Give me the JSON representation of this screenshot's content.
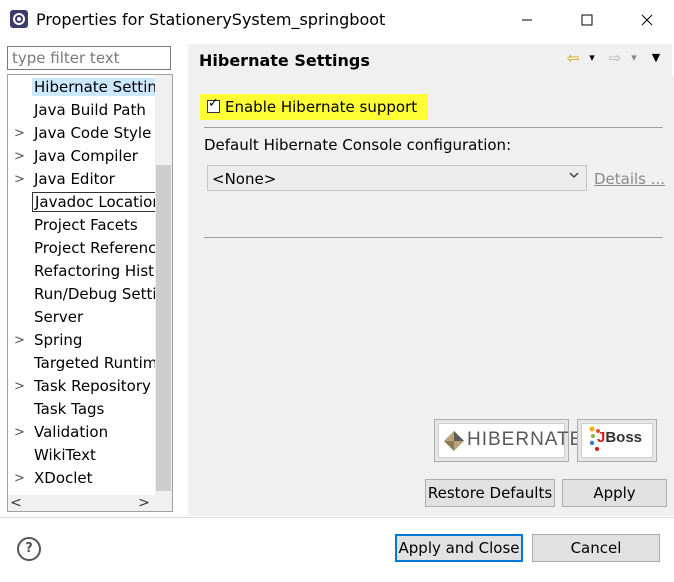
{
  "window": {
    "title": "Properties for StationerySystem_springboot",
    "minimize_icon": "minimize-icon",
    "maximize_icon": "maximize-icon",
    "close_icon": "close-icon"
  },
  "filter": {
    "placeholder": "type filter text"
  },
  "tree": {
    "items": [
      {
        "label": "Hibernate Settin",
        "expandable": false,
        "state": "selected"
      },
      {
        "label": "Java Build Path",
        "expandable": false
      },
      {
        "label": "Java Code Style",
        "expandable": true
      },
      {
        "label": "Java Compiler",
        "expandable": true
      },
      {
        "label": "Java Editor",
        "expandable": true
      },
      {
        "label": "Javadoc Location",
        "expandable": false,
        "state": "focused"
      },
      {
        "label": "Project Facets",
        "expandable": false
      },
      {
        "label": "Project Referenc",
        "expandable": false
      },
      {
        "label": "Refactoring Histo",
        "expandable": false
      },
      {
        "label": "Run/Debug Setti",
        "expandable": false
      },
      {
        "label": "Server",
        "expandable": false
      },
      {
        "label": "Spring",
        "expandable": true
      },
      {
        "label": "Targeted Runtim",
        "expandable": false
      },
      {
        "label": "Task Repository",
        "expandable": true
      },
      {
        "label": "Task Tags",
        "expandable": false
      },
      {
        "label": "Validation",
        "expandable": true
      },
      {
        "label": "WikiText",
        "expandable": false
      },
      {
        "label": "XDoclet",
        "expandable": true
      }
    ],
    "expand_glyph": ">",
    "scroll_left": "<",
    "scroll_right": ">"
  },
  "page": {
    "title": "Hibernate Settings",
    "nav": {
      "back_glyph": "⇦",
      "forward_glyph": "⇨",
      "dropdown_glyph": "▾",
      "menu_glyph": "▼"
    },
    "enable_support": {
      "label": "Enable Hibernate support",
      "checked": true,
      "highlight_color": "#ffff33"
    },
    "config": {
      "label": "Default Hibernate Console configuration:",
      "selected": "<None>",
      "details_link": "Details ..."
    },
    "logos": {
      "hibernate": "HIBERNATE",
      "jboss_j": "J",
      "jboss_rest": "Boss"
    }
  },
  "buttons": {
    "restore_defaults": "Restore Defaults",
    "apply": "Apply",
    "apply_and_close": "Apply and Close",
    "cancel": "Cancel"
  },
  "help": {
    "glyph": "?"
  }
}
